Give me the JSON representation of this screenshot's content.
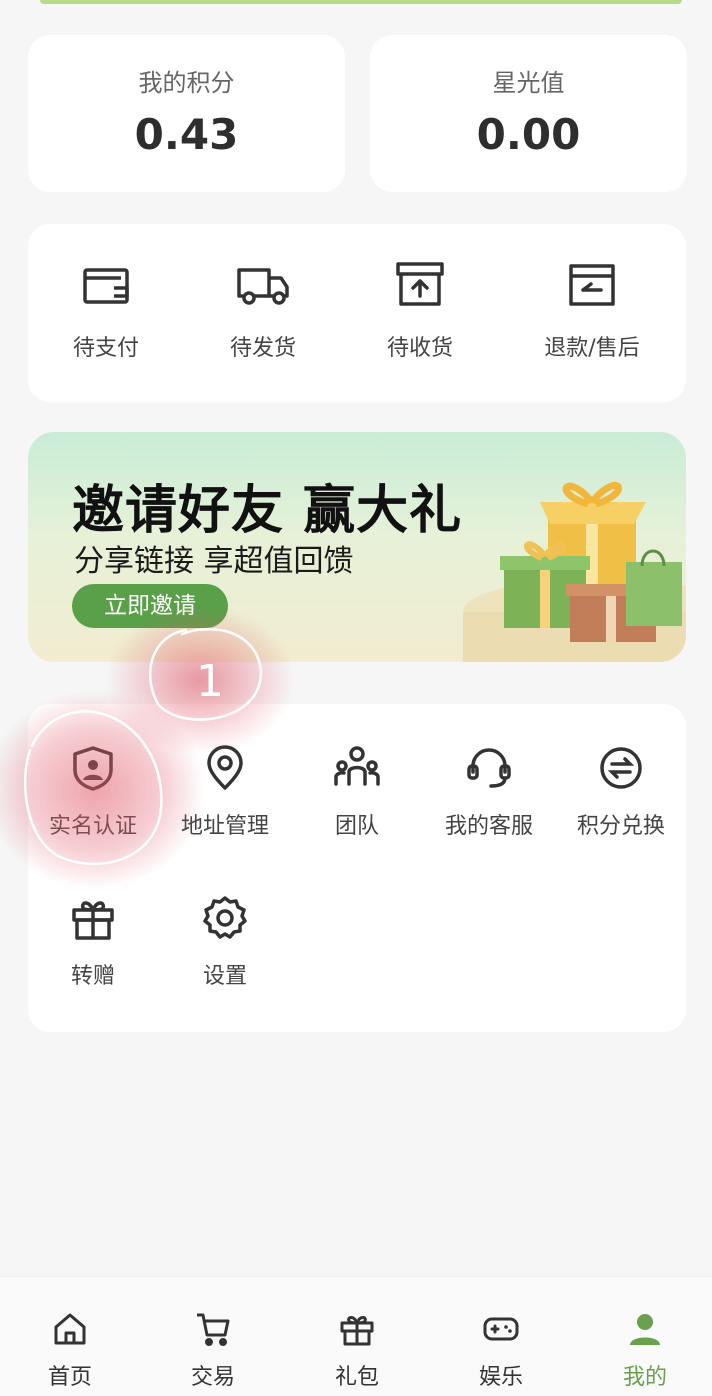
{
  "stats": {
    "points_label": "我的积分",
    "points_value": "0.43",
    "starlight_label": "星光值",
    "starlight_value": "0.00"
  },
  "orders": [
    {
      "label": "待支付",
      "icon": "wallet-icon"
    },
    {
      "label": "待发货",
      "icon": "truck-icon"
    },
    {
      "label": "待收货",
      "icon": "box-icon"
    },
    {
      "label": "退款/售后",
      "icon": "refund-icon"
    }
  ],
  "banner": {
    "title": "邀请好友 赢大礼",
    "subtitle": "分享链接 享超值回馈",
    "button": "立即邀请"
  },
  "services": [
    {
      "label": "实名认证",
      "icon": "id-shield-icon"
    },
    {
      "label": "地址管理",
      "icon": "location-pin-icon"
    },
    {
      "label": "团队",
      "icon": "team-icon"
    },
    {
      "label": "我的客服",
      "icon": "headset-icon"
    },
    {
      "label": "积分兑换",
      "icon": "exchange-icon"
    },
    {
      "label": "转赠",
      "icon": "gift-icon"
    },
    {
      "label": "设置",
      "icon": "gear-icon"
    }
  ],
  "annotation": {
    "mark": "1"
  },
  "tabbar": {
    "active": "我的",
    "items": [
      {
        "label": "首页",
        "icon": "home-icon"
      },
      {
        "label": "交易",
        "icon": "cart-icon"
      },
      {
        "label": "礼包",
        "icon": "gift-icon"
      },
      {
        "label": "娱乐",
        "icon": "gamepad-icon"
      },
      {
        "label": "我的",
        "icon": "user-icon"
      }
    ]
  },
  "colors": {
    "accent": "#6aa04e",
    "button_green": "#5aa049",
    "annotation_red": "#e05a6a"
  }
}
